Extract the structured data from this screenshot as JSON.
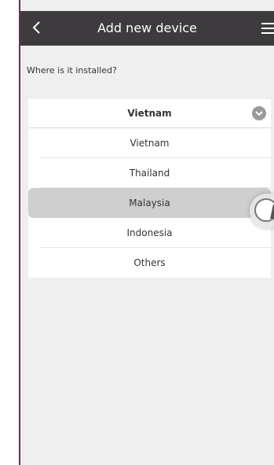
{
  "header": {
    "title": "Add new device",
    "back_icon": "chevron-left-icon",
    "menu_icon": "hamburger-menu-icon"
  },
  "form": {
    "question": "Where is it installed?",
    "selected_value": "Vietnam",
    "chevron_icon": "chevron-down-circle-icon"
  },
  "options": [
    {
      "label": "Vietnam"
    },
    {
      "label": "Thailand"
    },
    {
      "label": "Malaysia"
    },
    {
      "label": "Indonesia"
    },
    {
      "label": "Others"
    }
  ],
  "colors": {
    "header_bg": "#3d3b3d",
    "screen_bg": "#efeff0",
    "highlight_bg": "#cfcfcf",
    "border_accent": "#6a2c5a"
  }
}
